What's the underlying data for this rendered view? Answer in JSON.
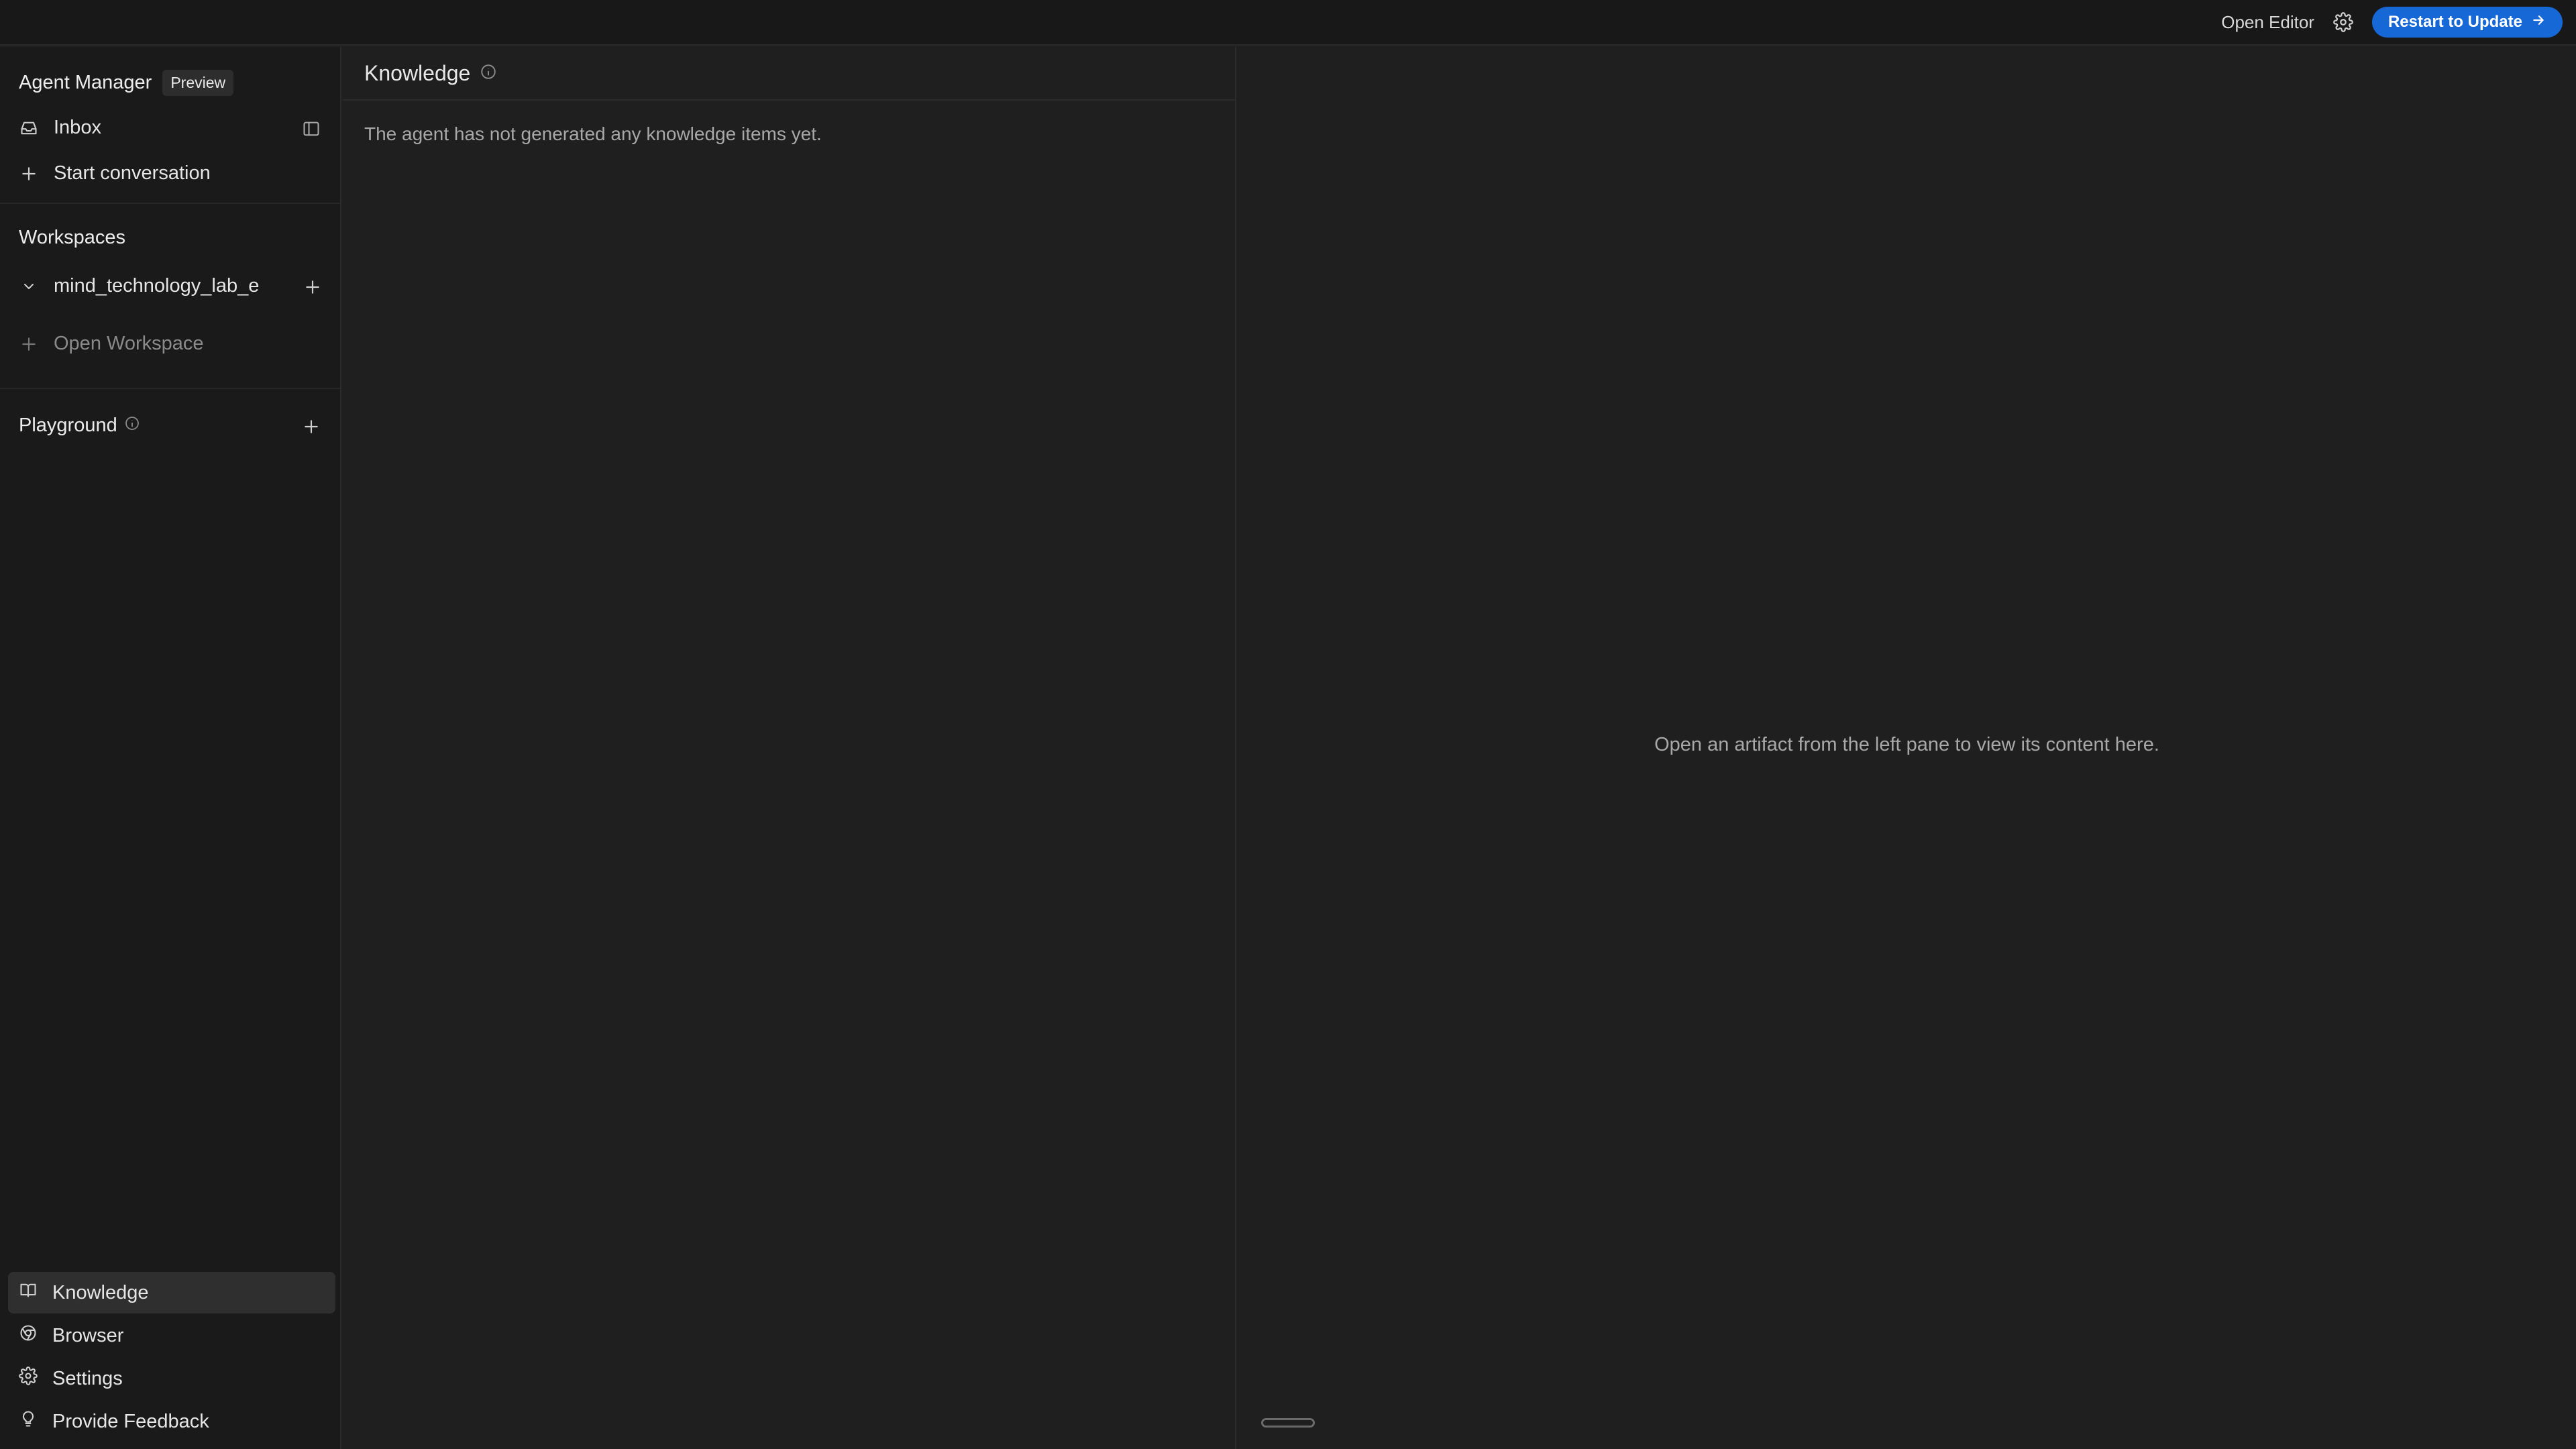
{
  "topbar": {
    "open_editor": "Open Editor",
    "restart_label": "Restart to Update",
    "restart_color": "#1668d6"
  },
  "sidebar": {
    "title": "Agent Manager",
    "badge": "Preview",
    "inbox": "Inbox",
    "start_conversation": "Start conversation",
    "workspaces_title": "Workspaces",
    "workspace_name": "mind_technology_lab_e",
    "open_workspace": "Open Workspace",
    "playground_title": "Playground",
    "bottom_nav": {
      "knowledge": "Knowledge",
      "browser": "Browser",
      "settings": "Settings",
      "feedback": "Provide Feedback"
    }
  },
  "knowledge": {
    "title": "Knowledge",
    "empty_message": "The agent has not generated any knowledge items yet."
  },
  "viewer": {
    "empty_message": "Open an artifact from the left pane to view its content here."
  },
  "icons": [
    "gear-icon",
    "arrow-right-icon",
    "inbox-icon",
    "sidebar-toggle-icon",
    "plus-icon",
    "chevron-down-icon",
    "info-icon",
    "book-icon",
    "chrome-icon",
    "feedback-icon"
  ]
}
